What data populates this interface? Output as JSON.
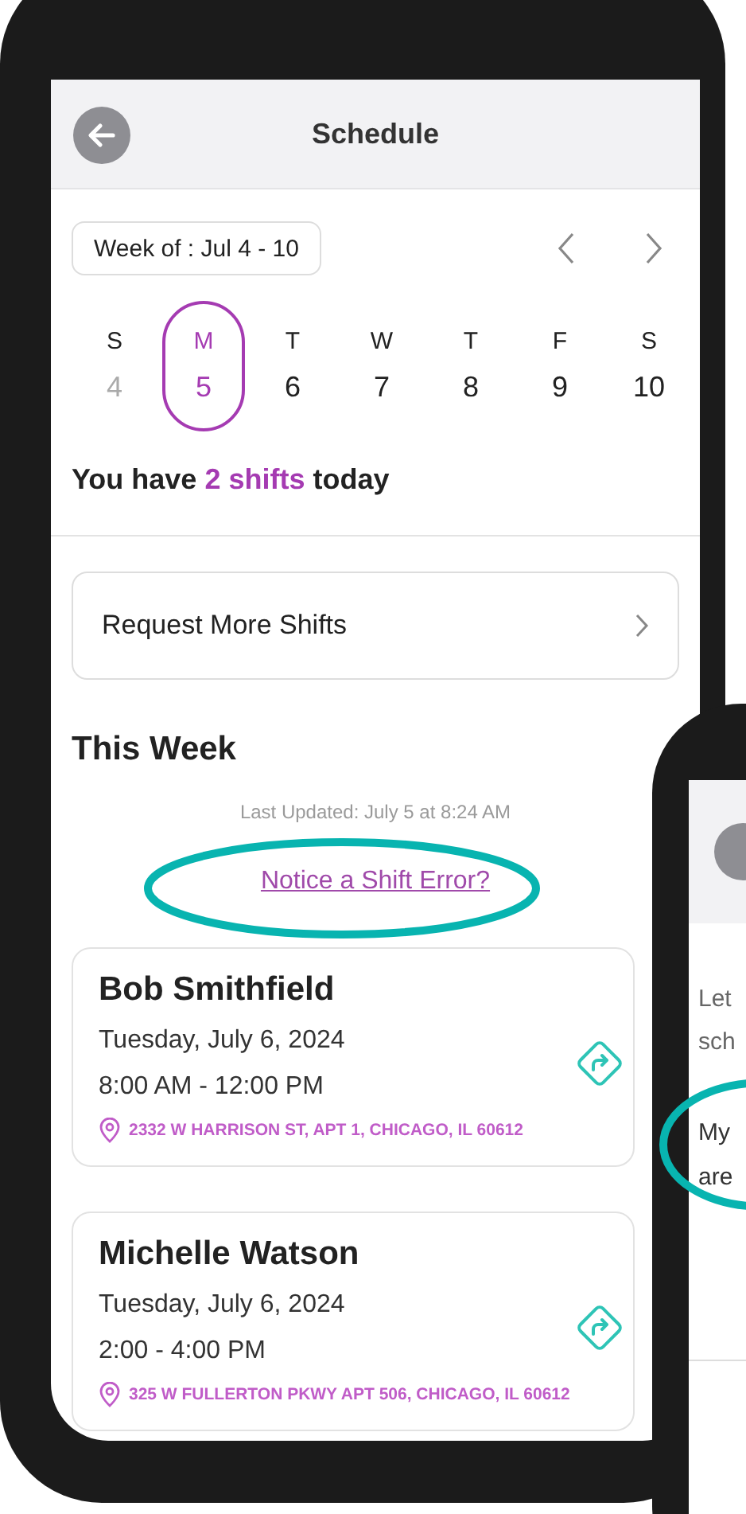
{
  "header": {
    "title": "Schedule"
  },
  "week": {
    "label": "Week of : Jul 4 - 10"
  },
  "days": [
    {
      "letter": "S",
      "number": "4",
      "selected": false,
      "muted": true
    },
    {
      "letter": "M",
      "number": "5",
      "selected": true,
      "muted": false
    },
    {
      "letter": "T",
      "number": "6",
      "selected": false,
      "muted": false
    },
    {
      "letter": "W",
      "number": "7",
      "selected": false,
      "muted": false
    },
    {
      "letter": "T",
      "number": "8",
      "selected": false,
      "muted": false
    },
    {
      "letter": "F",
      "number": "9",
      "selected": false,
      "muted": false
    },
    {
      "letter": "S",
      "number": "10",
      "selected": false,
      "muted": false
    }
  ],
  "summary": {
    "before": "You have",
    "highlight": "2 shifts",
    "after": "today"
  },
  "request": {
    "label": "Request More Shifts"
  },
  "this_week": {
    "title": "This Week",
    "last_updated": "Last Updated: July 5 at 8:24 AM",
    "error_link": "Notice a Shift Error?",
    "error_link_circled": true
  },
  "shifts": [
    {
      "name": "Bob Smithfield",
      "date": "Tuesday, July 6, 2024",
      "time": "8:00 AM - 12:00 PM",
      "address": "2332 W HARRISON ST, APT 1, CHICAGO, IL 60612"
    },
    {
      "name": "Michelle Watson",
      "date": "Tuesday, July 6, 2024",
      "time": "2:00 - 4:00 PM",
      "address": "325 W FULLERTON PKWY APT 506, CHICAGO, IL 60612"
    }
  ],
  "second_phone": {
    "intro": [
      "Let",
      "sch"
    ],
    "answer": [
      "My",
      "are"
    ],
    "answer_circled": true
  }
}
